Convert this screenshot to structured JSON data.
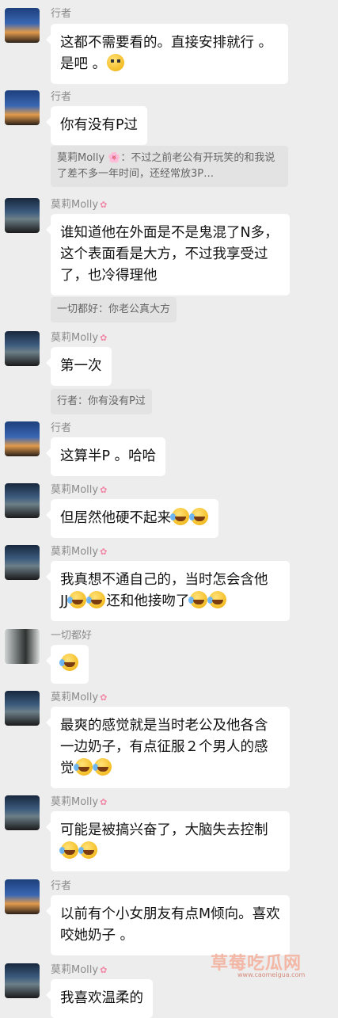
{
  "messages": [
    {
      "sender": "行者",
      "text": "这都不需要看的。直接安排就行 。是吧 。"
    },
    {
      "sender": "行者",
      "text": "你有没有P过",
      "quote": "莫莉Molly 🌸：不过之前老公有开玩笑的和我说了差不多一年时间，还经常放3P…"
    },
    {
      "sender": "莫莉Molly",
      "text": "谁知道他在外面是不是鬼混了N多，这个表面看是大方，不过我享受过了，也冷得理他",
      "quote": "一切都好：你老公真大方"
    },
    {
      "sender": "莫莉Molly",
      "text": "第一次",
      "quote": "行者：你有没有P过"
    },
    {
      "sender": "行者",
      "text": "这算半P 。哈哈"
    },
    {
      "sender": "莫莉Molly",
      "text": "但居然他硬不起来"
    },
    {
      "sender": "莫莉Molly",
      "text_a": "我真想不通自己的，当时怎会含他",
      "text_b1": "JJ",
      "text_b2": "还和他接吻了"
    },
    {
      "sender": "一切都好",
      "text": ""
    },
    {
      "sender": "莫莉Molly",
      "text": "最爽的感觉就是当时老公及他各含一边奶子，有点征服２个男人的感觉"
    },
    {
      "sender": "莫莉Molly",
      "text": "可能是被搞兴奋了，大脑失去控制"
    },
    {
      "sender": "行者",
      "text": "以前有个小女朋友有点M倾向。喜欢咬她奶子 。"
    },
    {
      "sender": "莫莉Molly",
      "text": "我喜欢温柔的"
    }
  ],
  "flower_icon": "flower-icon",
  "watermark": {
    "title": "草莓吃瓜网",
    "url": "www.caomeigua.com"
  }
}
